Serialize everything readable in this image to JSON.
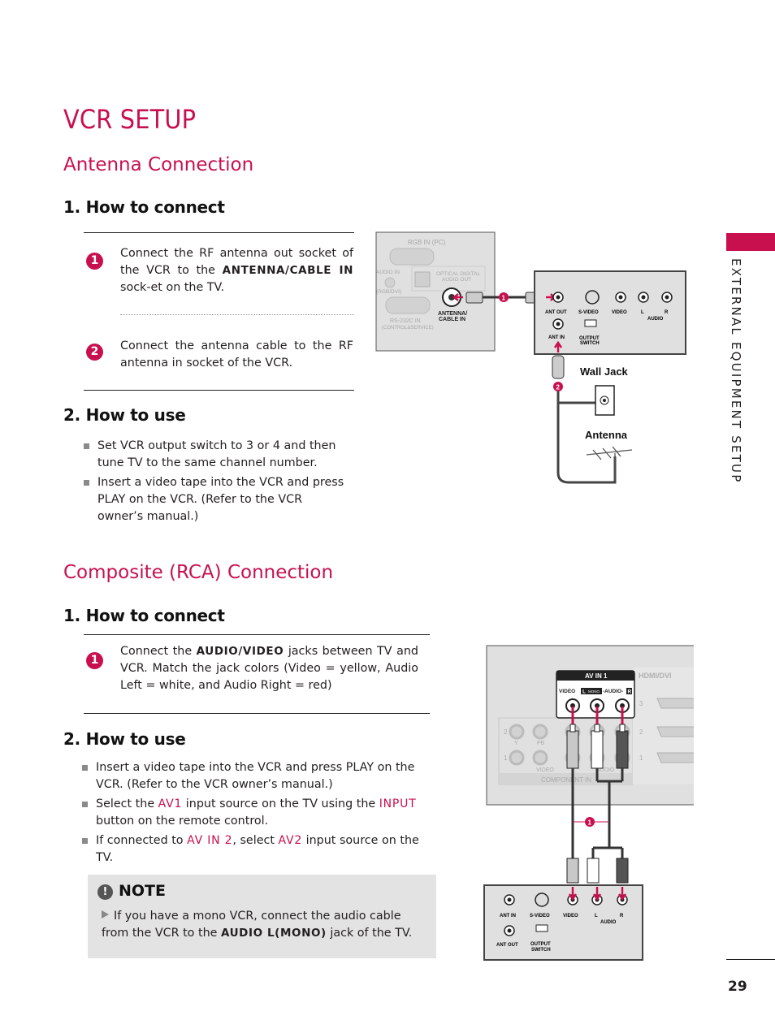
{
  "page": {
    "title": "VCR SETUP",
    "side_tab": "EXTERNAL EQUIPMENT SETUP",
    "page_number": "29",
    "accent_color": "#c8104e"
  },
  "antenna": {
    "heading": "Antenna Connection",
    "how_to_connect": "1. How to connect",
    "steps": [
      {
        "num": "1",
        "pre": "Connect the RF antenna out socket of the VCR to the ",
        "keyword": "ANTENNA/CABLE IN",
        "post": " sock-et on the TV."
      },
      {
        "num": "2",
        "text": "Connect the antenna cable to the RF antenna in socket of the VCR."
      }
    ],
    "how_to_use": "2. How to use",
    "use_bullets": [
      "Set VCR output switch to 3 or 4 and then tune TV to the same channel number.",
      "Insert a video tape into the VCR and press PLAY on the VCR. (Refer to the VCR owner’s manual.)"
    ],
    "diagram": {
      "tv_labels": {
        "rgb_in": "RGB IN (PC)",
        "audio_in": "AUDIO IN",
        "rgb_dvi": "(RGB/DVI)",
        "optical": "OPTICAL DIGITAL",
        "audio_out": "AUDIO OUT",
        "rs232": "RS-232C IN",
        "control": "(CONTROL&SERVICE)",
        "antenna_1": "ANTENNA/",
        "antenna_2": "CABLE IN"
      },
      "vcr_labels": {
        "ant_out": "ANT OUT",
        "s_video": "S-VIDEO",
        "video": "VIDEO",
        "l": "L",
        "r": "R",
        "audio": "AUDIO",
        "ant_in": "ANT IN",
        "output": "OUTPUT",
        "switch": "SWITCH"
      },
      "marker_1": "1",
      "marker_2": "2",
      "wall_jack": "Wall Jack",
      "antenna": "Antenna"
    }
  },
  "composite": {
    "heading": "Composite (RCA) Connection",
    "how_to_connect": "1. How to connect",
    "step": {
      "num": "1",
      "pre": "Connect the ",
      "keyword": "AUDIO/VIDEO",
      "post": " jacks between TV and VCR. Match the jack colors (Video = yellow, Audio Left = white, and Audio Right = red)"
    },
    "how_to_use": "2. How to use",
    "use_bullets": [
      {
        "pre": "Insert a video tape into the VCR and press PLAY on the VCR. (Refer to the VCR owner’s manual.)"
      },
      {
        "pre": "Select the ",
        "kw1": "AV1",
        "mid": " input source on the TV using the ",
        "kw2": "INPUT",
        "post": " button on the remote control."
      },
      {
        "pre": " If connected to ",
        "kw1": "AV IN 2",
        "mid": ", select ",
        "kw2": "AV2",
        "post": " input source on the TV."
      }
    ],
    "note": {
      "icon": "!",
      "title": "NOTE",
      "pre": "If you have a mono VCR, connect the audio cable from the VCR to the ",
      "keyword": "AUDIO L(MONO)",
      "post": " jack of the TV."
    },
    "diagram": {
      "av_in_1": "AV IN 1",
      "video": "VIDEO",
      "l_mono": "L",
      "mono": "MONO",
      "audio": "-AUDIO-",
      "r": "R",
      "hdmi": "HDMI/DVI",
      "hdmi_nums": [
        "3",
        "2",
        "1"
      ],
      "comp_nums": [
        "2",
        "1"
      ],
      "y": "Y",
      "pb": "PB",
      "comp_video": "VIDEO",
      "comp_audio": "AUDIO",
      "component_in": "COMPONENT IN",
      "marker_1": "1",
      "vcr_labels": {
        "ant_in": "ANT IN",
        "s_video": "S-VIDEO",
        "video": "VIDEO",
        "l": "L",
        "r": "R",
        "audio": "AUDIO",
        "ant_out": "ANT OUT",
        "output": "OUTPUT",
        "switch": "SWITCH"
      }
    }
  }
}
